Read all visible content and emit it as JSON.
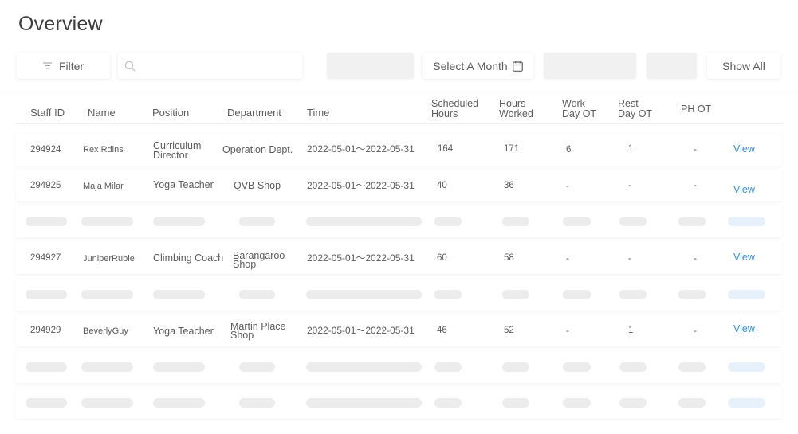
{
  "page": {
    "title": "Overview"
  },
  "toolbar": {
    "filter_label": "Filter",
    "search_placeholder": "",
    "search_value": "",
    "month_label": "Select A Month",
    "show_all_label": "Show All"
  },
  "table": {
    "headers": {
      "staff_id": "Staff ID",
      "name": "Name",
      "position": "Position",
      "department": "Department",
      "time": "Time",
      "scheduled_hours_1": "Scheduled",
      "scheduled_hours_2": "Hours",
      "hours_worked_1": "Hours",
      "hours_worked_2": "Worked",
      "work_day_ot_1": "Work",
      "work_day_ot_2": "Day OT",
      "rest_day_ot_1": "Rest",
      "rest_day_ot_2": "Day OT",
      "ph_ot": "PH OT"
    },
    "rows": [
      {
        "staff_id": "294924",
        "name": "Rex Rdins",
        "position_1": "Curriculum",
        "position_2": "Director",
        "department_1": "Operation Dept.",
        "department_2": "",
        "time": "2022-05-01～2022-05-31",
        "scheduled": "164",
        "worked": "171",
        "work_ot": "6",
        "rest_ot": "1",
        "ph_ot": "-",
        "view": "View"
      },
      {
        "staff_id": "294925",
        "name": "Maja Milar",
        "position_1": "Yoga Teacher",
        "position_2": "",
        "department_1": "QVB Shop",
        "department_2": "",
        "time": "2022-05-01～2022-05-31",
        "scheduled": "40",
        "worked": "36",
        "work_ot": "-",
        "rest_ot": "-",
        "ph_ot": "-",
        "view": "View"
      },
      {
        "staff_id": "294927",
        "name": "JuniperRuble",
        "position_1": "Climbing Coach",
        "position_2": "",
        "department_1": "Barangaroo",
        "department_2": "Shop",
        "time": "2022-05-01～2022-05-31",
        "scheduled": "60",
        "worked": "58",
        "work_ot": "-",
        "rest_ot": "-",
        "ph_ot": "-",
        "view": "View"
      },
      {
        "staff_id": "294929",
        "name": "BeverlyGuy",
        "position_1": "Yoga Teacher",
        "position_2": "",
        "department_1": "Martin Place",
        "department_2": "Shop",
        "time": "2022-05-01～2022-05-31",
        "scheduled": "46",
        "worked": "52",
        "work_ot": "-",
        "rest_ot": "1",
        "ph_ot": "-",
        "view": "View"
      }
    ]
  }
}
